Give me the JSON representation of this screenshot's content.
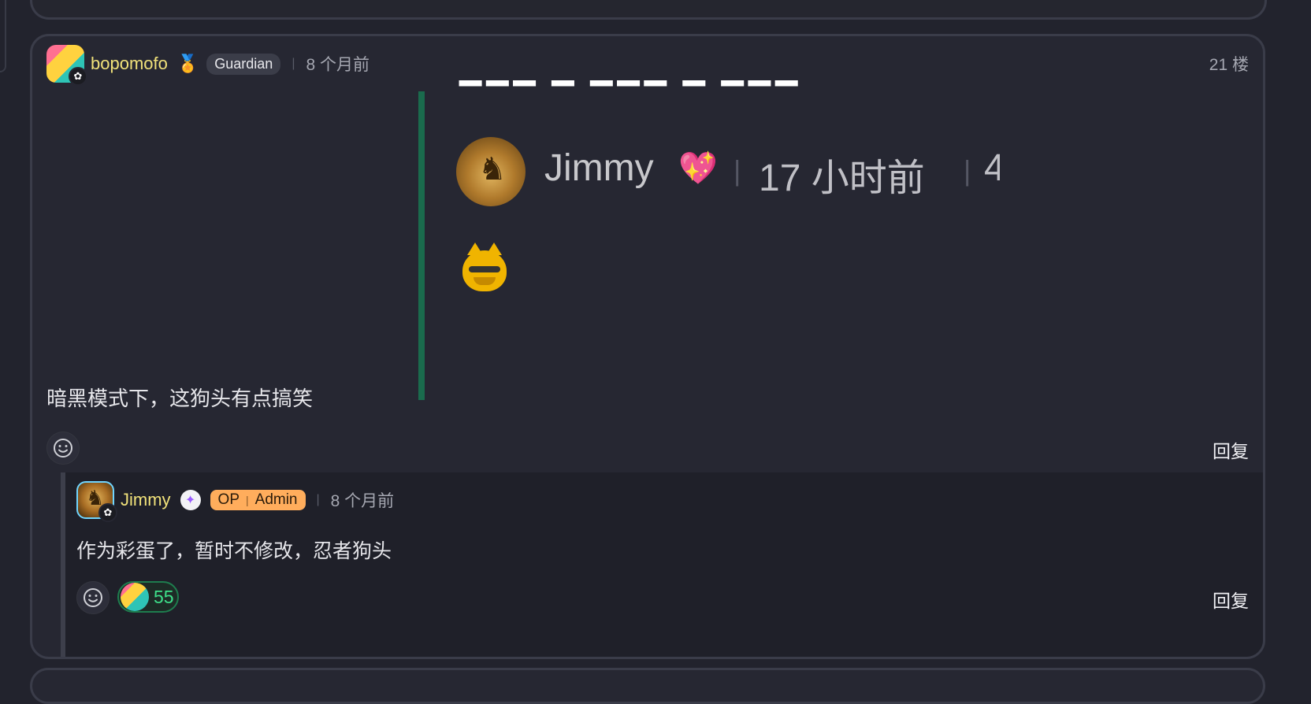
{
  "post": {
    "username": "bopomofo",
    "badge_label": "Guardian",
    "time": "8 个月前",
    "floor": "21 楼",
    "embed": {
      "name": "Jimmy",
      "time": "17 小时前",
      "trailing": "4"
    },
    "text": "暗黑模式下，这狗头有点搞笑",
    "reply_label": "回复"
  },
  "reply": {
    "username": "Jimmy",
    "op_label": "OP",
    "admin_label": "Admin",
    "time": "8 个月前",
    "text": "作为彩蛋了，暂时不修改，忍者狗头",
    "reaction_count": "55",
    "reply_label": "回复"
  },
  "icons": {
    "avatar_badge": "flower-icon",
    "medal": "medal-icon",
    "heart": "sparkling-heart-icon",
    "emoji_button": "smile-icon"
  },
  "colors": {
    "background": "#22232d",
    "card": "#262732",
    "username": "#f1e27a",
    "op_pill": "#ffad5c",
    "embed_bar": "#1a6b4d",
    "reaction": "#3ee08a"
  }
}
